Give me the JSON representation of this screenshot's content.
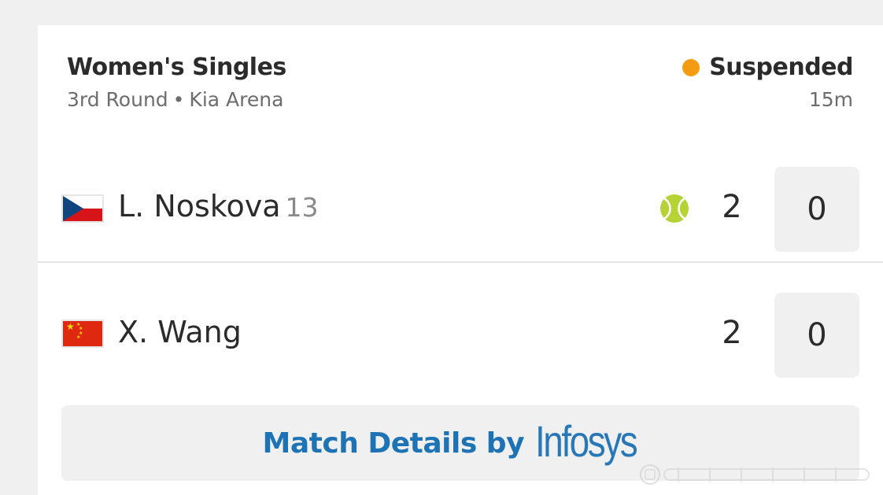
{
  "event": {
    "title": "Women's Singles",
    "round": "3rd Round",
    "separator": "•",
    "venue": "Kia Arena"
  },
  "status": {
    "label": "Suspended",
    "elapsed": "15m",
    "dot_color": "#f39c12"
  },
  "players": [
    {
      "name": "L. Noskova",
      "seed": "13",
      "flag": "czech-republic-flag-icon",
      "serving": true,
      "sets": "2",
      "games": "0"
    },
    {
      "name": "X. Wang",
      "seed": "",
      "flag": "china-flag-icon",
      "serving": false,
      "sets": "2",
      "games": "0"
    }
  ],
  "details_button": {
    "label": "Match Details by",
    "sponsor": "Infosys",
    "color": "#1e73b5"
  },
  "icons": {
    "serve": "tennis-ball-icon",
    "ball_color": "#b5d334"
  }
}
